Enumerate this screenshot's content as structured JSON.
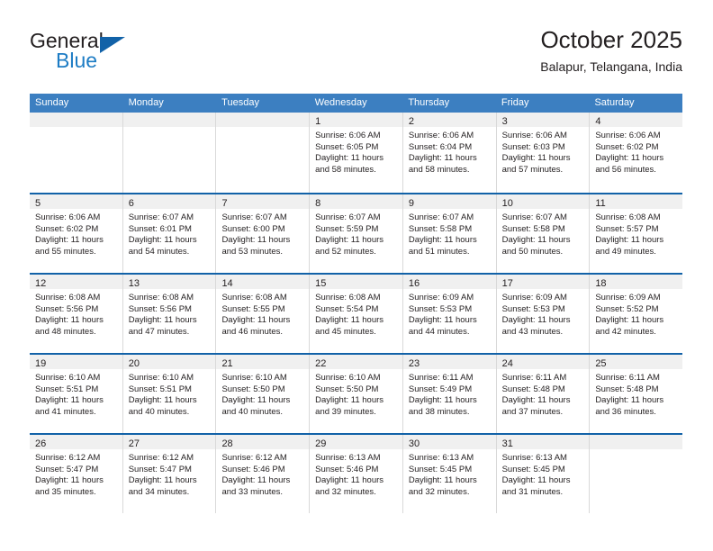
{
  "brand": {
    "word_one": "General",
    "word_two": "Blue",
    "logo_icon": "blue-triangle-icon"
  },
  "header": {
    "title": "October 2025",
    "location": "Balapur, Telangana, India"
  },
  "colors": {
    "header_band": "#3c7fc1",
    "week_rule": "#1262a8",
    "day_band": "#f0f0f0",
    "brand_blue": "#1d7cc4",
    "text": "#231f20"
  },
  "weekdays": [
    "Sunday",
    "Monday",
    "Tuesday",
    "Wednesday",
    "Thursday",
    "Friday",
    "Saturday"
  ],
  "labels": {
    "sunrise_prefix": "Sunrise:",
    "sunset_prefix": "Sunset:",
    "daylight_prefix": "Daylight:"
  },
  "weeks": [
    [
      {
        "day": "",
        "empty": true
      },
      {
        "day": "",
        "empty": true
      },
      {
        "day": "",
        "empty": true
      },
      {
        "day": "1",
        "sunrise": "Sunrise: 6:06 AM",
        "sunset": "Sunset: 6:05 PM",
        "daylight1": "Daylight: 11 hours",
        "daylight2": "and 58 minutes."
      },
      {
        "day": "2",
        "sunrise": "Sunrise: 6:06 AM",
        "sunset": "Sunset: 6:04 PM",
        "daylight1": "Daylight: 11 hours",
        "daylight2": "and 58 minutes."
      },
      {
        "day": "3",
        "sunrise": "Sunrise: 6:06 AM",
        "sunset": "Sunset: 6:03 PM",
        "daylight1": "Daylight: 11 hours",
        "daylight2": "and 57 minutes."
      },
      {
        "day": "4",
        "sunrise": "Sunrise: 6:06 AM",
        "sunset": "Sunset: 6:02 PM",
        "daylight1": "Daylight: 11 hours",
        "daylight2": "and 56 minutes."
      }
    ],
    [
      {
        "day": "5",
        "sunrise": "Sunrise: 6:06 AM",
        "sunset": "Sunset: 6:02 PM",
        "daylight1": "Daylight: 11 hours",
        "daylight2": "and 55 minutes."
      },
      {
        "day": "6",
        "sunrise": "Sunrise: 6:07 AM",
        "sunset": "Sunset: 6:01 PM",
        "daylight1": "Daylight: 11 hours",
        "daylight2": "and 54 minutes."
      },
      {
        "day": "7",
        "sunrise": "Sunrise: 6:07 AM",
        "sunset": "Sunset: 6:00 PM",
        "daylight1": "Daylight: 11 hours",
        "daylight2": "and 53 minutes."
      },
      {
        "day": "8",
        "sunrise": "Sunrise: 6:07 AM",
        "sunset": "Sunset: 5:59 PM",
        "daylight1": "Daylight: 11 hours",
        "daylight2": "and 52 minutes."
      },
      {
        "day": "9",
        "sunrise": "Sunrise: 6:07 AM",
        "sunset": "Sunset: 5:58 PM",
        "daylight1": "Daylight: 11 hours",
        "daylight2": "and 51 minutes."
      },
      {
        "day": "10",
        "sunrise": "Sunrise: 6:07 AM",
        "sunset": "Sunset: 5:58 PM",
        "daylight1": "Daylight: 11 hours",
        "daylight2": "and 50 minutes."
      },
      {
        "day": "11",
        "sunrise": "Sunrise: 6:08 AM",
        "sunset": "Sunset: 5:57 PM",
        "daylight1": "Daylight: 11 hours",
        "daylight2": "and 49 minutes."
      }
    ],
    [
      {
        "day": "12",
        "sunrise": "Sunrise: 6:08 AM",
        "sunset": "Sunset: 5:56 PM",
        "daylight1": "Daylight: 11 hours",
        "daylight2": "and 48 minutes."
      },
      {
        "day": "13",
        "sunrise": "Sunrise: 6:08 AM",
        "sunset": "Sunset: 5:56 PM",
        "daylight1": "Daylight: 11 hours",
        "daylight2": "and 47 minutes."
      },
      {
        "day": "14",
        "sunrise": "Sunrise: 6:08 AM",
        "sunset": "Sunset: 5:55 PM",
        "daylight1": "Daylight: 11 hours",
        "daylight2": "and 46 minutes."
      },
      {
        "day": "15",
        "sunrise": "Sunrise: 6:08 AM",
        "sunset": "Sunset: 5:54 PM",
        "daylight1": "Daylight: 11 hours",
        "daylight2": "and 45 minutes."
      },
      {
        "day": "16",
        "sunrise": "Sunrise: 6:09 AM",
        "sunset": "Sunset: 5:53 PM",
        "daylight1": "Daylight: 11 hours",
        "daylight2": "and 44 minutes."
      },
      {
        "day": "17",
        "sunrise": "Sunrise: 6:09 AM",
        "sunset": "Sunset: 5:53 PM",
        "daylight1": "Daylight: 11 hours",
        "daylight2": "and 43 minutes."
      },
      {
        "day": "18",
        "sunrise": "Sunrise: 6:09 AM",
        "sunset": "Sunset: 5:52 PM",
        "daylight1": "Daylight: 11 hours",
        "daylight2": "and 42 minutes."
      }
    ],
    [
      {
        "day": "19",
        "sunrise": "Sunrise: 6:10 AM",
        "sunset": "Sunset: 5:51 PM",
        "daylight1": "Daylight: 11 hours",
        "daylight2": "and 41 minutes."
      },
      {
        "day": "20",
        "sunrise": "Sunrise: 6:10 AM",
        "sunset": "Sunset: 5:51 PM",
        "daylight1": "Daylight: 11 hours",
        "daylight2": "and 40 minutes."
      },
      {
        "day": "21",
        "sunrise": "Sunrise: 6:10 AM",
        "sunset": "Sunset: 5:50 PM",
        "daylight1": "Daylight: 11 hours",
        "daylight2": "and 40 minutes."
      },
      {
        "day": "22",
        "sunrise": "Sunrise: 6:10 AM",
        "sunset": "Sunset: 5:50 PM",
        "daylight1": "Daylight: 11 hours",
        "daylight2": "and 39 minutes."
      },
      {
        "day": "23",
        "sunrise": "Sunrise: 6:11 AM",
        "sunset": "Sunset: 5:49 PM",
        "daylight1": "Daylight: 11 hours",
        "daylight2": "and 38 minutes."
      },
      {
        "day": "24",
        "sunrise": "Sunrise: 6:11 AM",
        "sunset": "Sunset: 5:48 PM",
        "daylight1": "Daylight: 11 hours",
        "daylight2": "and 37 minutes."
      },
      {
        "day": "25",
        "sunrise": "Sunrise: 6:11 AM",
        "sunset": "Sunset: 5:48 PM",
        "daylight1": "Daylight: 11 hours",
        "daylight2": "and 36 minutes."
      }
    ],
    [
      {
        "day": "26",
        "sunrise": "Sunrise: 6:12 AM",
        "sunset": "Sunset: 5:47 PM",
        "daylight1": "Daylight: 11 hours",
        "daylight2": "and 35 minutes."
      },
      {
        "day": "27",
        "sunrise": "Sunrise: 6:12 AM",
        "sunset": "Sunset: 5:47 PM",
        "daylight1": "Daylight: 11 hours",
        "daylight2": "and 34 minutes."
      },
      {
        "day": "28",
        "sunrise": "Sunrise: 6:12 AM",
        "sunset": "Sunset: 5:46 PM",
        "daylight1": "Daylight: 11 hours",
        "daylight2": "and 33 minutes."
      },
      {
        "day": "29",
        "sunrise": "Sunrise: 6:13 AM",
        "sunset": "Sunset: 5:46 PM",
        "daylight1": "Daylight: 11 hours",
        "daylight2": "and 32 minutes."
      },
      {
        "day": "30",
        "sunrise": "Sunrise: 6:13 AM",
        "sunset": "Sunset: 5:45 PM",
        "daylight1": "Daylight: 11 hours",
        "daylight2": "and 32 minutes."
      },
      {
        "day": "31",
        "sunrise": "Sunrise: 6:13 AM",
        "sunset": "Sunset: 5:45 PM",
        "daylight1": "Daylight: 11 hours",
        "daylight2": "and 31 minutes."
      },
      {
        "day": "",
        "empty": true
      }
    ]
  ]
}
